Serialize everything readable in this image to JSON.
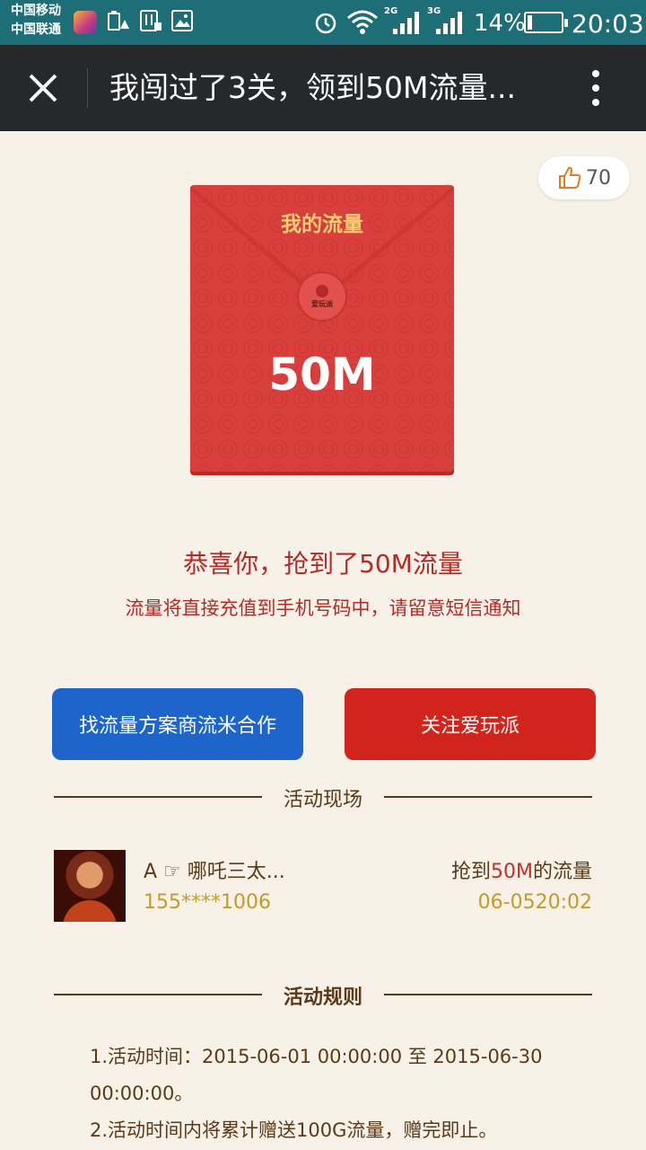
{
  "status_bar": {
    "carrier_1": "中国移动",
    "carrier_2": "中国联通",
    "net_2g": "2G",
    "net_3g": "3G",
    "battery_percent": "14%",
    "battery_level": 0.14,
    "time": "20:03",
    "icons": [
      "app-icon",
      "battery-warning-icon",
      "settings-lock-icon",
      "image-icon",
      "alarm-icon",
      "wifi-icon",
      "signal-2g-icon",
      "signal-3g-icon",
      "battery-icon"
    ]
  },
  "nav": {
    "title": "我闯过了3关，领到50M流量...",
    "close_icon": "close-icon",
    "more_icon": "more-vertical-icon"
  },
  "like": {
    "count": "70",
    "icon": "thumbs-up-icon"
  },
  "envelope": {
    "label": "我的流量",
    "amount": "50M",
    "seal_text": "爱玩派"
  },
  "message": {
    "congrats": "恭喜你，抢到了50M流量",
    "notice": "流量将直接充值到手机号码中，请留意短信通知"
  },
  "buttons": {
    "partner": "找流量方案商流米合作",
    "follow": "关注爱玩派"
  },
  "live": {
    "title": "活动现场",
    "records": [
      {
        "name": "A ☞ 哪吒三太...",
        "phone": "155****1006",
        "result_prefix": "抢到",
        "result_amount": "50M",
        "result_suffix": "的流量",
        "time": "06-0520:02"
      }
    ]
  },
  "rules": {
    "title": "活动规则",
    "items": [
      "1.活动时间：2015-06-01 00:00:00 至 2015-06-30 00:00:00。",
      "2.活动时间内将累计赠送100G流量，赠完即止。"
    ]
  },
  "colors": {
    "status_bar": "#1e6e78",
    "nav_bar": "#26292b",
    "background": "#f7f1e7",
    "envelope_red": "#d9403d",
    "accent_red": "#b52a27",
    "button_blue": "#1d64cb",
    "button_red": "#d0241d",
    "brown_text": "#5a3a18",
    "gold_text": "#c39b2a"
  }
}
